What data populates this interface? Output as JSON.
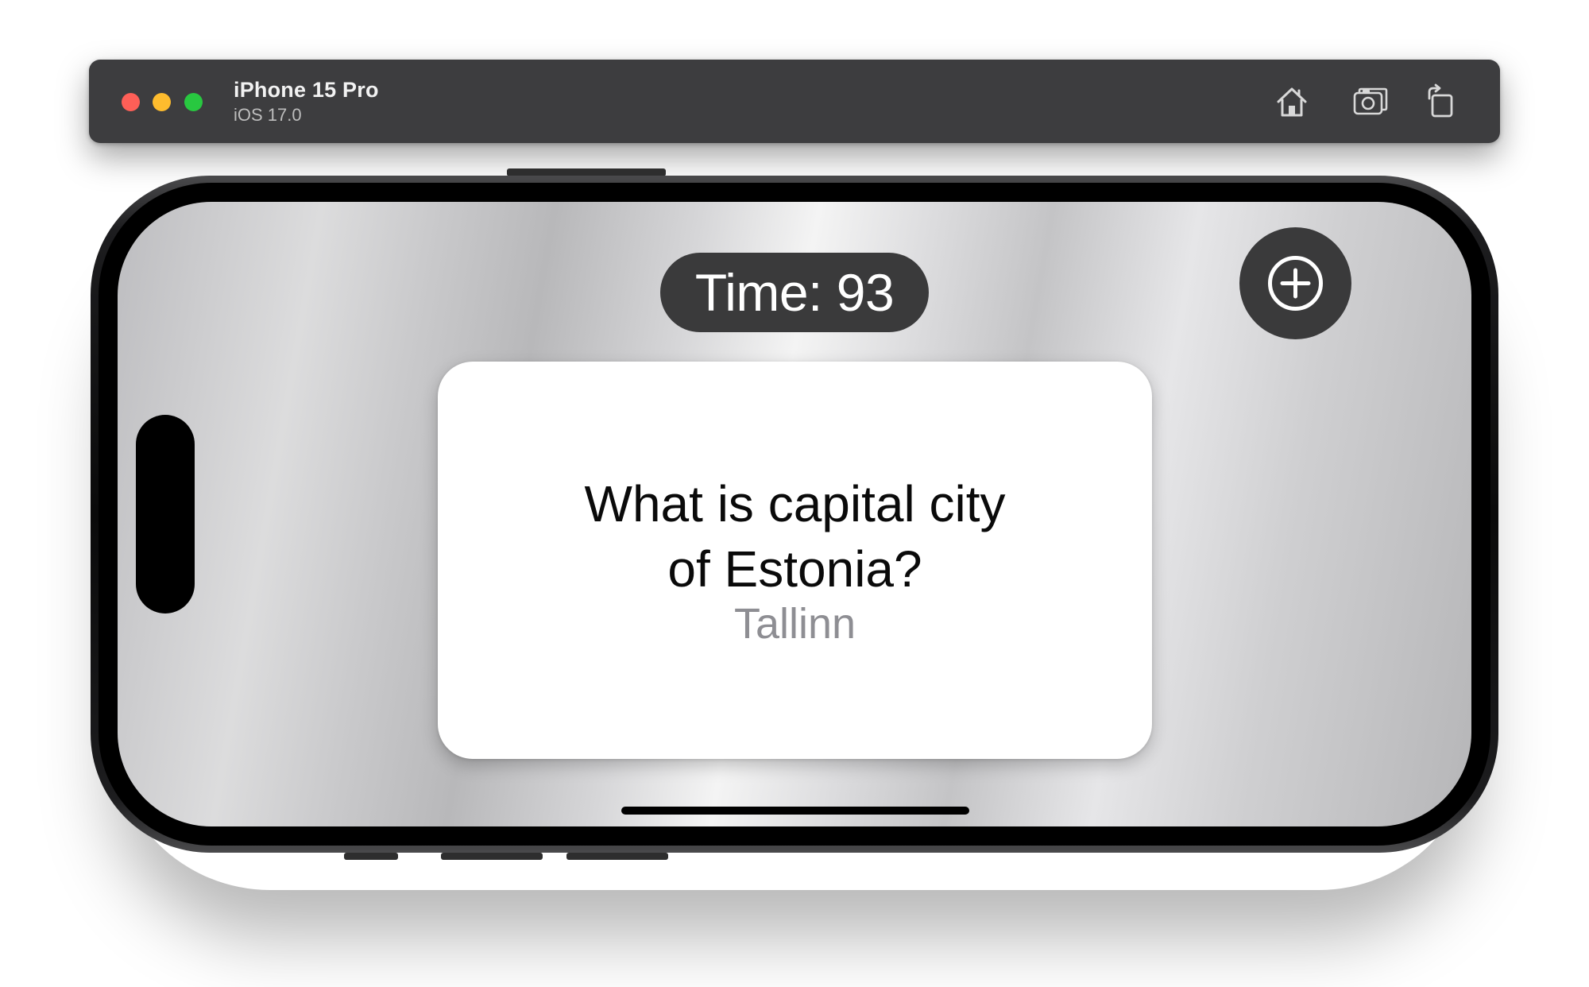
{
  "simulator": {
    "device_name": "iPhone 15 Pro",
    "os_version": "iOS 17.0",
    "toolbar": [
      {
        "icon": "home-icon"
      },
      {
        "icon": "screenshot-icon"
      },
      {
        "icon": "rotate-icon"
      }
    ],
    "window_controls": [
      "close",
      "minimize",
      "zoom"
    ]
  },
  "app": {
    "timer_label": "Time: 93",
    "add_button_icon": "plus-circle-icon",
    "card": {
      "question_line1": "What is capital city",
      "question_line2": "of Estonia?",
      "answer": "Tallinn"
    }
  },
  "colors": {
    "pill_background": "#3a3a3b",
    "card_background": "#ffffff",
    "question_text": "#0a0a0a",
    "answer_text": "#8e8e93",
    "titlebar": "#3d3d3f"
  }
}
